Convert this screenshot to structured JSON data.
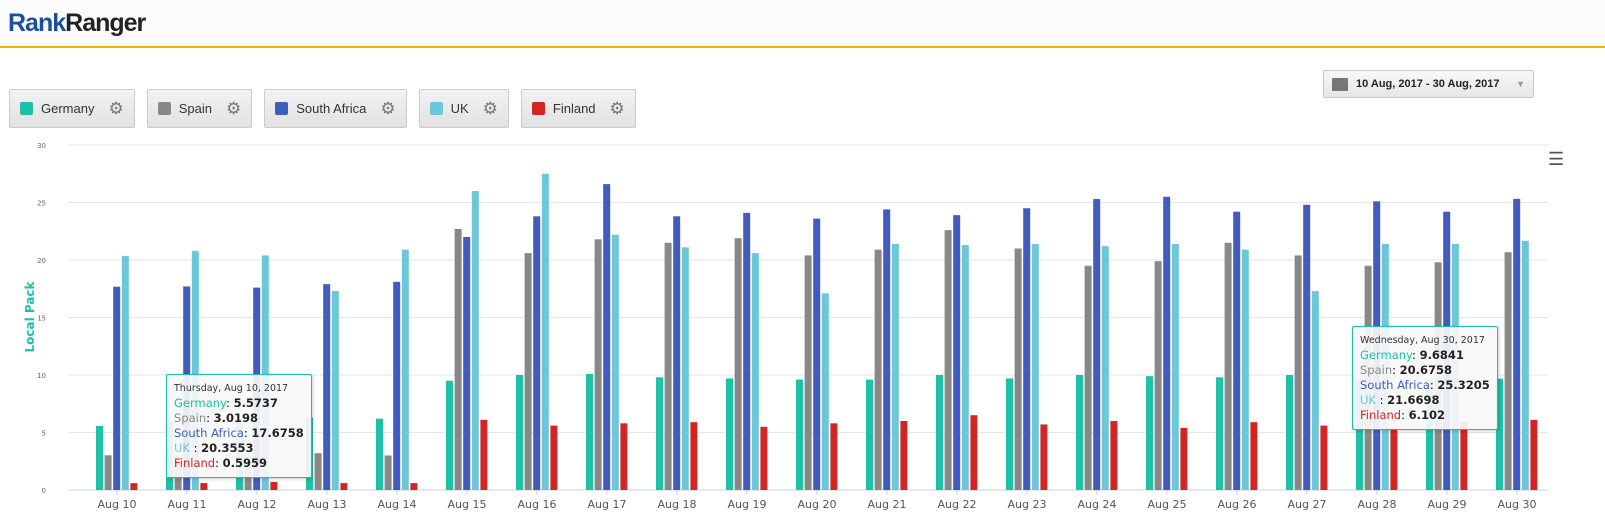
{
  "logo": {
    "part1": "Rank",
    "part2": "Ranger"
  },
  "date_range": "10 Aug, 2017 - 30 Aug, 2017",
  "legend": [
    {
      "label": "Germany",
      "color": "#1dc1a5"
    },
    {
      "label": "Spain",
      "color": "#888888"
    },
    {
      "label": "South Africa",
      "color": "#425cbd"
    },
    {
      "label": "UK",
      "color": "#6cc8d8"
    },
    {
      "label": "Finland",
      "color": "#d42525"
    }
  ],
  "tooltips": [
    {
      "date": "Thursday, Aug 10, 2017",
      "rows": [
        [
          "Germany",
          "5.5737"
        ],
        [
          "Spain",
          "3.0198"
        ],
        [
          "South Africa",
          "17.6758"
        ],
        [
          "UK ",
          "20.3553"
        ],
        [
          "Finland",
          "0.5959"
        ]
      ]
    },
    {
      "date": "Wednesday, Aug 30, 2017",
      "rows": [
        [
          "Germany",
          "9.6841"
        ],
        [
          "Spain",
          "20.6758"
        ],
        [
          "South Africa",
          "25.3205"
        ],
        [
          "UK ",
          "21.6698"
        ],
        [
          "Finland",
          "6.102"
        ]
      ]
    }
  ],
  "chart_data": {
    "type": "bar",
    "title": "",
    "xlabel": "",
    "ylabel": "Local Pack",
    "ylim": [
      0,
      30
    ],
    "yticks": [
      0,
      5,
      10,
      15,
      20,
      25,
      30
    ],
    "grid": true,
    "categories": [
      "Aug 10",
      "Aug 11",
      "Aug 12",
      "Aug 13",
      "Aug 14",
      "Aug 15",
      "Aug 16",
      "Aug 17",
      "Aug 18",
      "Aug 19",
      "Aug 20",
      "Aug 21",
      "Aug 22",
      "Aug 23",
      "Aug 24",
      "Aug 25",
      "Aug 26",
      "Aug 27",
      "Aug 28",
      "Aug 29",
      "Aug 30"
    ],
    "series": [
      {
        "name": "Germany",
        "color": "#1dc1a5",
        "values": [
          5.5737,
          5.9,
          5.9,
          6.3,
          6.2,
          9.5,
          10.0,
          10.1,
          9.8,
          9.7,
          9.6,
          9.6,
          10.0,
          9.7,
          10.0,
          9.9,
          9.8,
          10.0,
          9.5,
          9.6,
          9.6841
        ]
      },
      {
        "name": "Spain",
        "color": "#888888",
        "values": [
          3.0198,
          3.0,
          3.0,
          3.2,
          3.0,
          22.7,
          20.6,
          21.8,
          21.5,
          21.9,
          20.4,
          20.9,
          22.6,
          21.0,
          19.5,
          19.9,
          21.5,
          20.4,
          19.5,
          19.8,
          20.6758
        ]
      },
      {
        "name": "South Africa",
        "color": "#425cbd",
        "values": [
          17.6758,
          17.7,
          17.6,
          17.9,
          18.1,
          22.0,
          23.8,
          26.6,
          23.8,
          24.1,
          23.6,
          24.4,
          23.9,
          24.5,
          25.3,
          25.5,
          24.2,
          24.8,
          25.1,
          24.2,
          25.3205
        ]
      },
      {
        "name": "UK",
        "color": "#6cc8d8",
        "values": [
          20.3553,
          20.8,
          20.4,
          17.3,
          20.9,
          26.0,
          27.5,
          22.2,
          21.1,
          20.6,
          17.1,
          21.4,
          21.3,
          21.4,
          21.2,
          21.4,
          20.9,
          17.3,
          21.4,
          21.4,
          21.6698
        ]
      },
      {
        "name": "Finland",
        "color": "#d42525",
        "values": [
          0.5959,
          0.6,
          0.7,
          0.6,
          0.6,
          6.1,
          5.6,
          5.8,
          5.9,
          5.5,
          5.8,
          6.0,
          6.5,
          5.7,
          6.0,
          5.4,
          5.9,
          5.6,
          5.4,
          5.9,
          6.102
        ]
      }
    ]
  }
}
